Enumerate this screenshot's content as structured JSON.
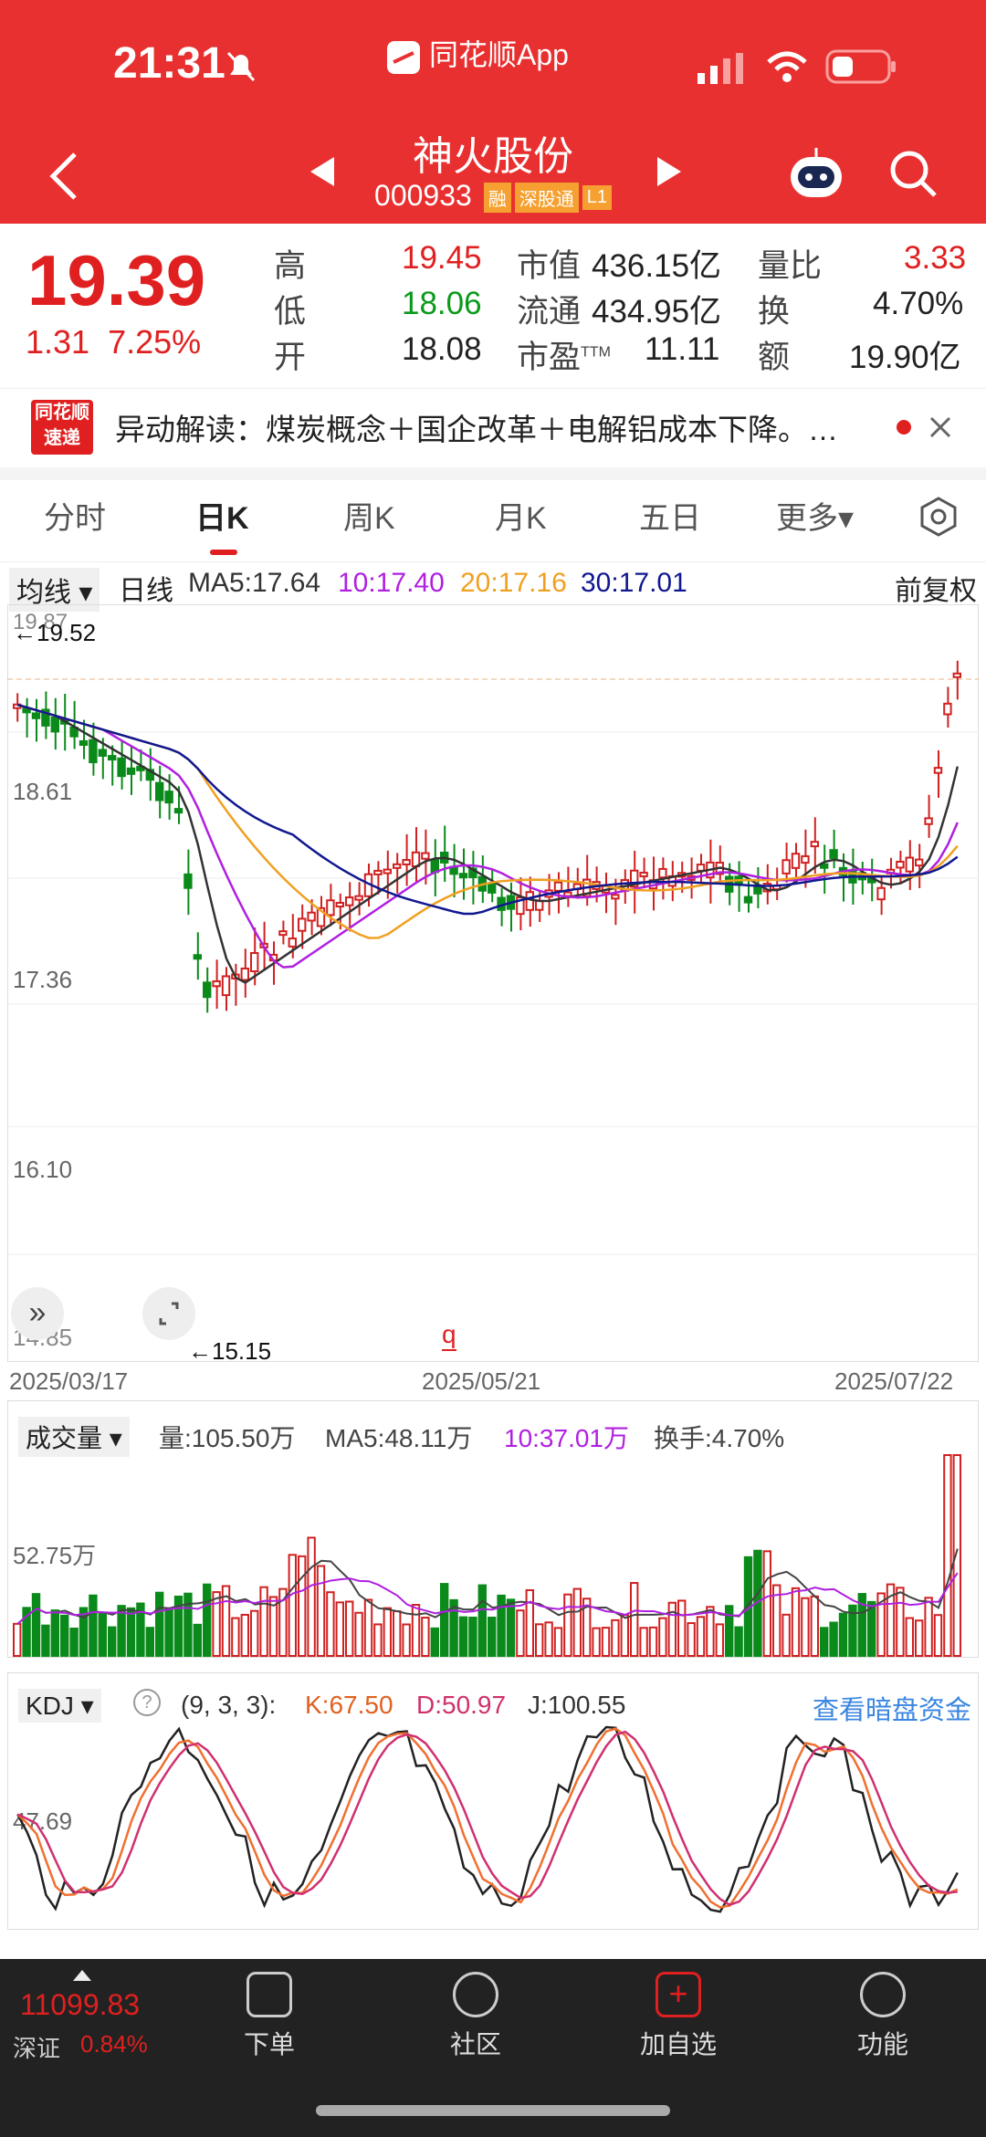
{
  "status": {
    "time": "21:31",
    "app": "同花顺App"
  },
  "stock": {
    "name": "神火股份",
    "code": "000933",
    "tags": [
      "融",
      "深股通",
      "L1"
    ]
  },
  "quote": {
    "price": "19.39",
    "change": "1.31",
    "pct": "7.25%",
    "high_l": "高",
    "high": "19.45",
    "low_l": "低",
    "low": "18.06",
    "open_l": "开",
    "open": "18.08",
    "mcap_l": "市值",
    "mcap": "436.15亿",
    "float_l": "流通",
    "float": "434.95亿",
    "pe_l": "市盈",
    "pe_sup": "TTM",
    "pe": "11.11",
    "vr_l": "量比",
    "vr": "3.33",
    "turn_l": "换",
    "turn": "4.70%",
    "amt_l": "额",
    "amt": "19.90亿"
  },
  "news": {
    "logo1": "同花顺",
    "logo2": "速递",
    "text": "异动解读：煤炭概念＋国企改革＋电解铝成本下降。…"
  },
  "tabs": [
    "分时",
    "日K",
    "周K",
    "月K",
    "五日",
    "更多▾"
  ],
  "kline": {
    "ma_select": "均线 ▾",
    "period": "日线",
    "ma5": "MA5:17.64",
    "ma10": "10:17.40",
    "ma20": "20:17.16",
    "ma30": "30:17.01",
    "adjust": "前复权",
    "y_top": "19.87",
    "y_1": "18.61",
    "y_2": "17.36",
    "y_3": "16.10",
    "y_bot": "14.85",
    "hi_mark": "←19.52",
    "lo_mark": "←15.15",
    "dates": [
      "2025/03/17",
      "2025/05/21",
      "2025/07/22"
    ],
    "colors": {
      "ma5": "#333333",
      "ma10": "#b020e0",
      "ma20": "#f0a020",
      "ma30": "#101890",
      "up": "#d02020",
      "down": "#0a8a1a"
    }
  },
  "volume": {
    "select": "成交量 ▾",
    "vol": "量:105.50万",
    "ma5": "MA5:48.11万",
    "ma10": "10:37.01万",
    "turnover": "换手:4.70%",
    "y_label": "52.75万"
  },
  "kdj": {
    "select": "KDJ ▾",
    "help": "?",
    "params": "(9, 3, 3):",
    "k": "K:67.50",
    "d": "D:50.97",
    "j": "J:100.55",
    "link": "查看暗盘资金",
    "y_label": "47.69"
  },
  "bottom": {
    "index_value": "11099.83",
    "index_name": "深证",
    "index_pct": "0.84%",
    "nav": [
      "下单",
      "社区",
      "加自选",
      "功能"
    ]
  }
}
